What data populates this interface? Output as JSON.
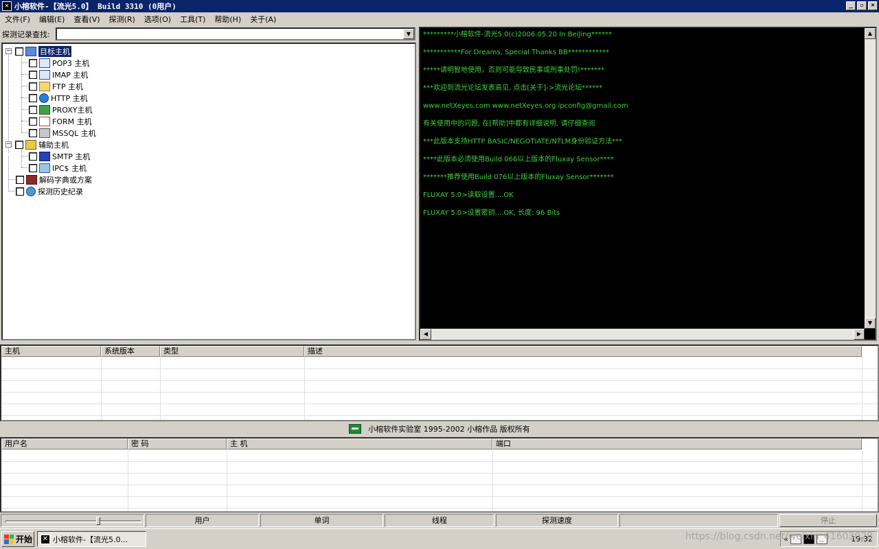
{
  "window": {
    "title": "小榕软件-【流光5.0】 Build 3310 (0用户)",
    "controls": [
      "_",
      "▫",
      "×"
    ]
  },
  "menu": [
    "文件(F)",
    "编辑(E)",
    "查看(V)",
    "探测(R)",
    "选项(O)",
    "工具(T)",
    "帮助(H)",
    "关于(A)"
  ],
  "search": {
    "label": "探测记录查找:",
    "value": ""
  },
  "tree": {
    "target_hosts": "目标主机",
    "pop3": "POP3 主机",
    "imap": "IMAP 主机",
    "ftp": "FTP 主机",
    "http": "HTTP 主机",
    "proxy": "PROXY主机",
    "form": "FORM 主机",
    "mssql": "MSSQL 主机",
    "aux_hosts": "辅助主机",
    "smtp": "SMTP 主机",
    "ipc": "IPC$ 主机",
    "dictionary": "解码字典或方案",
    "history": "探测历史纪录",
    "expander_expanded": "−"
  },
  "console": {
    "lines": [
      "*********小榕软件-流光5.0(c)2006.05.20 In BeiJing******",
      "***********For Dreams, Special Thanks BB************",
      "*****请明智地使用，否则可能导致民事或刑事处罚!*******",
      "***欢迎到流光论坛发表高见, 点击[关于]->流光论坛******",
      "www.netXeyes.com www.netXeyes.org ipconfig@gmail.com",
      "有关使用中的问题, 在[帮助]中都有详细说明, 请仔细查阅",
      "***此版本支持HTTP BASIC/NEGOTIATE/NTLM身份验证方法***",
      "****此版本必须使用Build 066以上版本的Fluxay Sensor****",
      "*******推荐使用Build 076以上版本的Fluxay Sensor*******",
      "FLUXAY 5.0>读取设置....OK",
      "FLUXAY 5.0>设置密钥....OK, 长度: 96 Bits"
    ],
    "text_color": "#3ed13e"
  },
  "hosts_table": {
    "columns": [
      "主机",
      "系统版本",
      "类型",
      "描述"
    ]
  },
  "copyright": "小榕软件实验室 1995-2002 小榕作品 版权所有",
  "results_table": {
    "columns": [
      "用户名",
      "密 码",
      "主 机",
      "端口"
    ]
  },
  "status": {
    "users": "用户",
    "words": "单词",
    "threads": "线程",
    "speed": "探测速度",
    "stop": "停止"
  },
  "taskbar": {
    "start": "开始",
    "task": "小榕软件-【流光5.0...",
    "tray_chevron": "«",
    "clock": "19:32",
    "watermark": "https://blog.csdn.net/weixin_41603028"
  },
  "colors": {
    "titlebar": "#0a246a",
    "console_bg": "#000000",
    "face": "#d4d0c8"
  }
}
